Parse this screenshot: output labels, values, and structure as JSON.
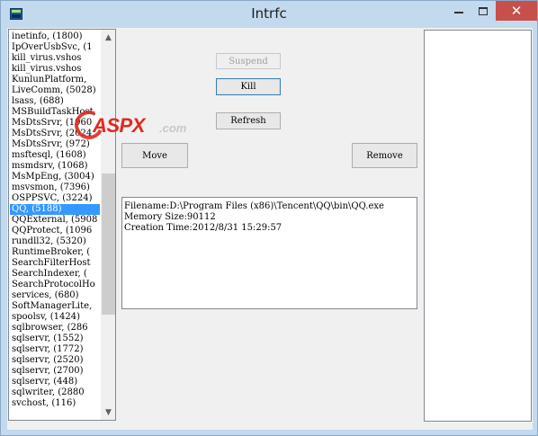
{
  "window": {
    "title": "Intrfc",
    "close_glyph": "✕"
  },
  "process_list": {
    "selected_index": 16,
    "items": [
      "inetinfo, (1800)",
      "IpOverUsbSvc, (1",
      "kill_virus.vshos",
      "kill_virus.vshos",
      "KunlunPlatform,",
      "LiveComm, (5028)",
      "lsass, (688)",
      "MSBuildTaskHost,",
      "MsDtsSrvr, (1960",
      "MsDtsSrvr, (2024",
      "MsDtsSrvr, (972)",
      "msftesql, (1608)",
      "msmdsrv, (1068)",
      "MsMpEng, (3004)",
      "msvsmon, (7396)",
      "OSPPSVC, (3224)",
      "QQ, (5188)",
      "QQExternal, (5908",
      "QQProtect, (1096",
      "rundll32, (5320)",
      "RuntimeBroker, (",
      "SearchFilterHost",
      "SearchIndexer, (",
      "SearchProtocolHo",
      "services, (680)",
      "SoftManagerLite,",
      "spoolsv, (1424)",
      "sqlbrowser, (286",
      "sqlservr, (1552)",
      "sqlservr, (1772)",
      "sqlservr, (2520)",
      "sqlservr, (2700)",
      "sqlservr, (448)",
      "sqlwriter, (2880",
      "svchost, (116)"
    ],
    "scroll_up": "▲",
    "scroll_down": "▼"
  },
  "buttons": {
    "suspend": "Suspend",
    "kill": "Kill",
    "refresh": "Refresh",
    "move": "Move",
    "remove": "Remove"
  },
  "info": {
    "filename": "Filename:D:\\Program Files (x86)\\Tencent\\QQ\\bin\\QQ.exe",
    "memory": "Memory Size:90112",
    "creation": "Creation Time:2012/8/31 15:29:57"
  },
  "watermark": {
    "brand": "ASPX",
    "tld": ".com",
    "color": "#e02a1e"
  }
}
